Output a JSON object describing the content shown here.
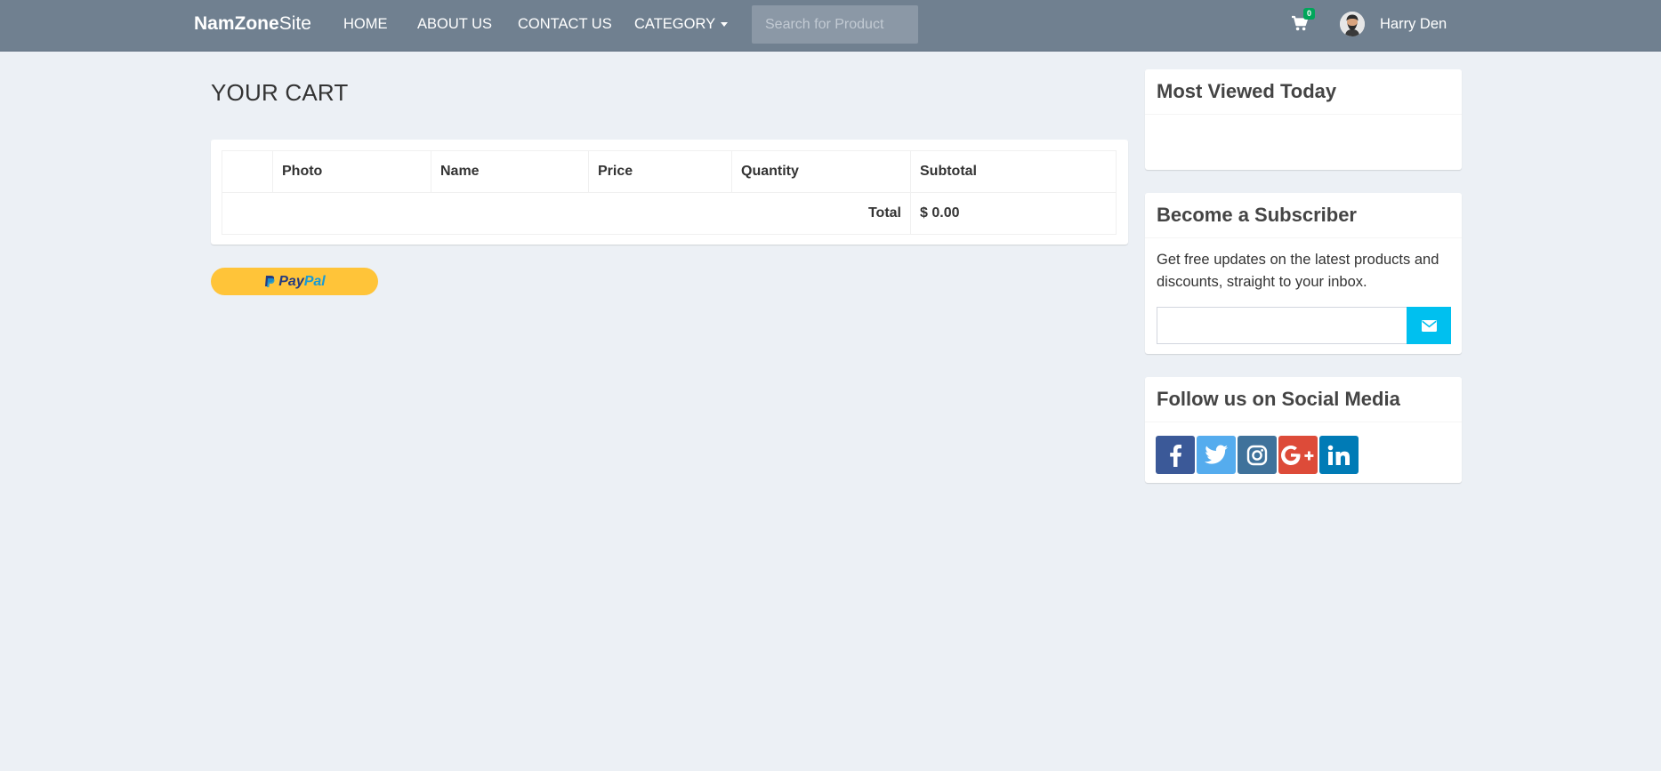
{
  "navbar": {
    "brand_bold": "NamZone",
    "brand_light": "Site",
    "links": [
      "HOME",
      "ABOUT US",
      "CONTACT US",
      "CATEGORY"
    ],
    "search_placeholder": "Search for Product",
    "cart_count": "0",
    "cart_icon": "shopping-cart-icon",
    "user_name": "Harry Den"
  },
  "main": {
    "title": "YOUR CART",
    "table": {
      "headers": [
        "",
        "Photo",
        "Name",
        "Price",
        "Quantity",
        "Subtotal"
      ],
      "total_label": "Total",
      "total_value": "$ 0.00"
    },
    "paypal": {
      "pay": "Pay",
      "pal": "Pal"
    }
  },
  "sidebar": {
    "most_viewed_title": "Most Viewed Today",
    "subscriber_title": "Become a Subscriber",
    "subscriber_text": "Get free updates on the latest products and discounts, straight to your inbox.",
    "subscriber_icon": "envelope-icon",
    "social_title": "Follow us on Social Media",
    "social": [
      {
        "name": "facebook",
        "color": "#3b5998"
      },
      {
        "name": "twitter",
        "color": "#55acee"
      },
      {
        "name": "instagram",
        "color": "#3f729b"
      },
      {
        "name": "google-plus",
        "color": "#dd4b39"
      },
      {
        "name": "linkedin",
        "color": "#007bb6"
      }
    ]
  },
  "colors": {
    "navbar_bg": "#708090",
    "page_bg": "#ecf0f5",
    "badge": "#00a65a",
    "subscribe_button": "#00c0ef",
    "paypal_button": "#ffc439"
  }
}
